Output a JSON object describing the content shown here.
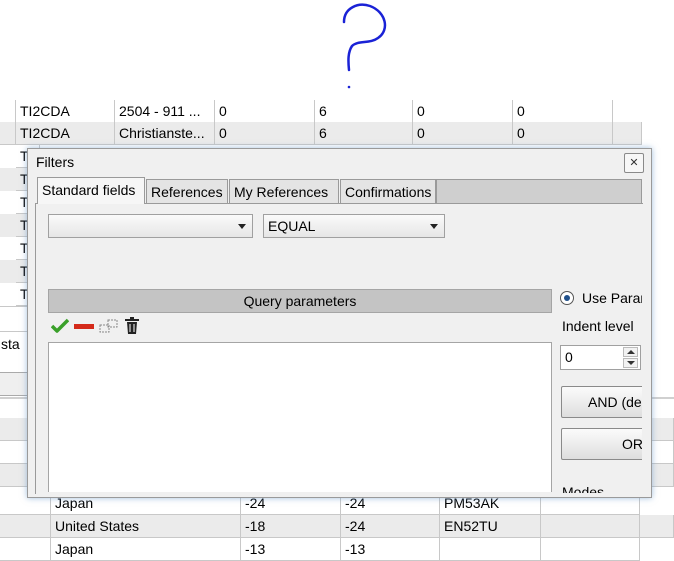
{
  "bg_table": {
    "top_rows": [
      [
        "TI2CDA",
        "2504 - 911 ...",
        "0",
        "6",
        "0",
        "0"
      ],
      [
        "TI2CDA",
        "Christianste...",
        "0",
        "6",
        "0",
        "0"
      ],
      [
        "T"
      ],
      [
        "T"
      ],
      [
        "T"
      ],
      [
        "T"
      ],
      [
        "T"
      ],
      [
        "T"
      ],
      [
        "T"
      ]
    ],
    "side_fragment": "l sta",
    "bottom_rows": [
      [
        "",
        "Japan",
        "-24",
        "-24",
        "PM53AK",
        ""
      ],
      [
        "",
        "United States",
        "-18",
        "-24",
        "EN52TU",
        ""
      ],
      [
        "",
        "Japan",
        "-13",
        "-13",
        "",
        ""
      ]
    ]
  },
  "dialog": {
    "title": "Filters",
    "close_glyph": "✕",
    "tabs": [
      "Standard fields",
      "References",
      "My References",
      "Confirmations"
    ],
    "field_combo_value": "",
    "operator_combo_value": "EQUAL",
    "query_header": "Query parameters",
    "use_params_label": "Use Parar",
    "indent_label": "Indent level",
    "indent_value": "0",
    "and_button": "AND (de",
    "or_button": "OR",
    "modes_label": "Modes"
  },
  "colors": {
    "accent_green": "#3aa02a",
    "accent_red": "#d42a1a",
    "header_gray": "#c4c4c4",
    "scribble_blue": "#1a22d6"
  },
  "icons": [
    "check-icon",
    "remove-icon",
    "duplicate-icon",
    "trash-icon",
    "close-icon",
    "question-mark-scribble"
  ]
}
